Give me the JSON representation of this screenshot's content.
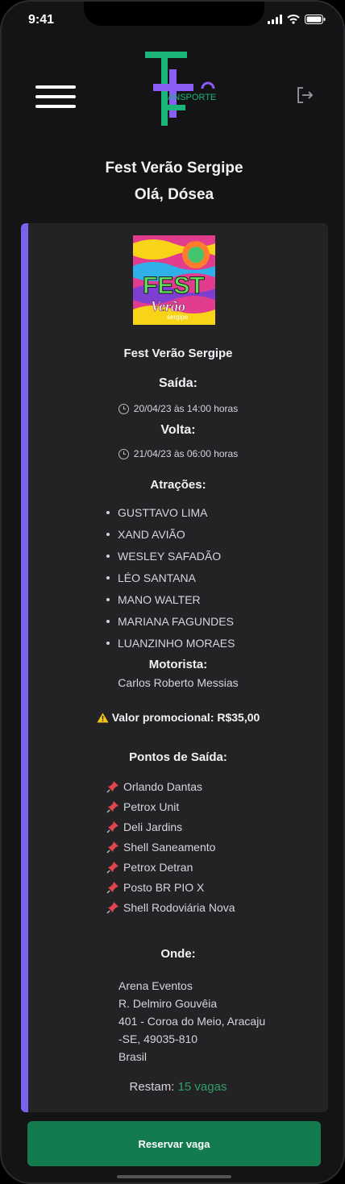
{
  "status_bar": {
    "time": "9:41"
  },
  "header": {
    "logo_text": "RANSPORTE",
    "title": "Fest Verão Sergipe",
    "greeting": "Olá, Dósea"
  },
  "event": {
    "poster_text_1": "FEST",
    "poster_text_2": "Verão",
    "poster_text_3": "sergipe",
    "name": "Fest Verão Sergipe",
    "departure_label": "Saída:",
    "departure_datetime": "20/04/23 às 14:00 horas",
    "return_label": "Volta:",
    "return_datetime": "21/04/23 às 06:00 horas",
    "attractions_label": "Atrações:",
    "attractions": [
      "GUSTTAVO LIMA",
      "XAND AVIÃO",
      "WESLEY SAFADÃO",
      "LÉO SANTANA",
      "MANO WALTER",
      "MARIANA FAGUNDES",
      "LUANZINHO MORAES"
    ],
    "driver_label": "Motorista:",
    "driver_name": "Carlos Roberto Messias",
    "promo_text": "Valor promocional: R$35,00",
    "pickup_label": "Pontos de Saída:",
    "pickup_points": [
      "Orlando Dantas",
      "Petrox Unit",
      "Deli Jardins",
      "Shell Saneamento",
      "Petrox Detran",
      "Posto BR PIO X",
      "Shell Rodoviária Nova"
    ],
    "where_label": "Onde:",
    "address_lines": [
      "Arena Eventos",
      "R. Delmiro Gouvêia",
      "401 - Coroa do Meio, Aracaju",
      "-SE, 49035-810",
      "Brasil"
    ],
    "remaining_label": "Restam:",
    "remaining_value": "15 vagas"
  },
  "actions": {
    "reserve_label": "Reservar vaga"
  },
  "colors": {
    "accent": "#7b61ee",
    "brand_green": "#137b4d",
    "vagas_green": "#2f9e66",
    "background": "#141416",
    "card": "#232326"
  },
  "icons": {
    "menu": "hamburger-icon",
    "logout": "logout-icon",
    "clock": "clock-icon",
    "warning": "warning-icon",
    "pin": "pushpin-icon"
  }
}
